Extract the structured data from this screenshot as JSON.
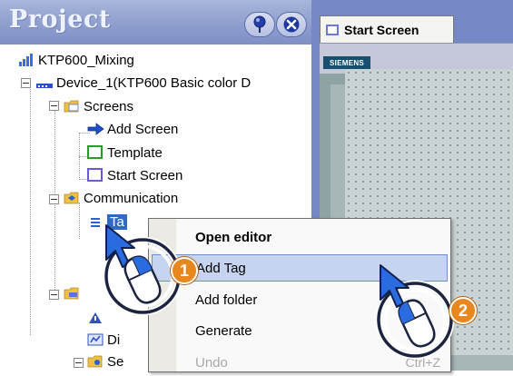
{
  "project": {
    "title": "Project",
    "tree": {
      "root": "KTP600_Mixing",
      "device": "Device_1(KTP600 Basic color D",
      "screens": "Screens",
      "add_screen": "Add Screen",
      "template": "Template",
      "start_screen": "Start Screen",
      "communication": "Communication",
      "tags_partial": "Ta",
      "item_di": "Di",
      "item_se": "Se"
    }
  },
  "editor": {
    "tab_label": "Start Screen",
    "brand": "SIEMENS"
  },
  "context_menu": {
    "items": [
      {
        "label": "Open editor"
      },
      {
        "label": "Add Tag"
      },
      {
        "label": "Add folder"
      },
      {
        "label": "Generate"
      },
      {
        "label": "Undo",
        "shortcut": "Ctrl+Z"
      }
    ]
  },
  "callouts": {
    "step1": "1",
    "step2": "2"
  },
  "colors": {
    "panel_header": "#8c9ccd",
    "editor_bg": "#7587c4",
    "highlight": "#c6d4ef",
    "badge": "#e8871e"
  }
}
